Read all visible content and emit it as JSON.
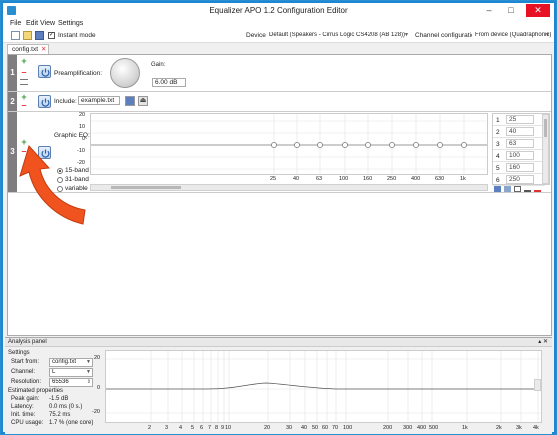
{
  "window": {
    "title": "Equalizer APO 1.2 Configuration Editor",
    "minimize": "–",
    "maximize": "□",
    "close": "✕",
    "close_color": "#e81123"
  },
  "menu": [
    "File",
    "Edit",
    "View",
    "Settings"
  ],
  "toolbar": {
    "icons": [
      "new-file-icon",
      "open-file-icon",
      "save-file-icon"
    ],
    "instant_mode_checked": true,
    "instant_mode_label": "Instant mode",
    "device_label": "Device:",
    "device_value": "Default (Speakers - Cirrus Logic CS4208 (AB 128))",
    "channel_config_label": "Channel configuration:",
    "channel_config_value": "From device (Quadraphonic)"
  },
  "tab": {
    "label": "config.txt",
    "close": "✕"
  },
  "filters": {
    "preamp": {
      "number": "1",
      "label": "Preamplification:",
      "gain_label": "Gain:",
      "gain_value": "6.00 dB"
    },
    "include": {
      "number": "2",
      "label": "Include:",
      "file": "example.txt"
    },
    "geq": {
      "number": "3",
      "label": "Graphic EQ:",
      "band_options": [
        "15-band",
        "31-band",
        "variable"
      ],
      "selected_band": "15-band",
      "y_ticks": [
        "20",
        "10",
        "0",
        "-10",
        "-20"
      ],
      "x_ticks": [
        "25",
        "40",
        "63",
        "100",
        "160",
        "250",
        "400",
        "630",
        "1k"
      ],
      "bands": [
        {
          "index": "1",
          "freq": "25"
        },
        {
          "index": "2",
          "freq": "40"
        },
        {
          "index": "3",
          "freq": "63"
        },
        {
          "index": "4",
          "freq": "100"
        },
        {
          "index": "5",
          "freq": "160"
        },
        {
          "index": "6",
          "freq": "250"
        }
      ],
      "toolbar_icons": [
        "copy-icon",
        "paste-icon",
        "import-icon",
        "bars-icon",
        "reset-icon"
      ]
    }
  },
  "analysis": {
    "title": "Analysis panel",
    "header_controls": "▴ ✕",
    "settings_heading": "Settings",
    "start_from_label": "Start from:",
    "start_from_value": "config.txt",
    "channel_label": "Channel:",
    "channel_value": "L",
    "resolution_label": "Resolution:",
    "resolution_value": "65536",
    "estimated_heading": "Estimated properties",
    "peak_gain_label": "Peak gain:",
    "peak_gain_value": "-1.5 dB",
    "latency_label": "Latency:",
    "latency_value": "0.0 ms (0 s.)",
    "init_time_label": "Init. time:",
    "init_time_value": "75.2 ms",
    "cpu_label": "CPU usage:",
    "cpu_value": "1.7 % (one core)",
    "y_ticks": [
      "20",
      "0",
      "-20"
    ],
    "x_ticks": [
      "2",
      "3",
      "4",
      "5",
      "6",
      "7",
      "8",
      "9",
      "10",
      "20",
      "30",
      "40",
      "50",
      "60",
      "70",
      "100",
      "200",
      "300",
      "400",
      "500",
      "1k",
      "2k",
      "3k",
      "4k"
    ]
  },
  "arrow_color": "#f0531d"
}
